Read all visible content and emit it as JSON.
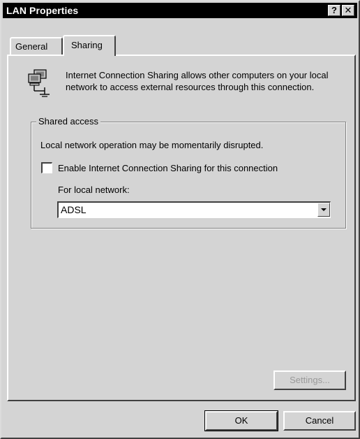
{
  "window": {
    "title": "LAN Properties",
    "help_button": "?",
    "close_button": "✕"
  },
  "tabs": [
    {
      "label": "General",
      "selected": false
    },
    {
      "label": "Sharing",
      "selected": true
    }
  ],
  "sharing": {
    "intro": "Internet Connection Sharing allows other computers on your local network to access external resources through this connection.",
    "icon": "network-computers-icon",
    "group_title": "Shared access",
    "disruption_text": "Local network operation may be momentarily disrupted.",
    "enable_checkbox": {
      "label": "Enable Internet Connection Sharing for this connection",
      "checked": false
    },
    "local_network_label": "For local network:",
    "local_network_value": "ADSL",
    "settings_label": "Settings..."
  },
  "footer": {
    "ok_label": "OK",
    "cancel_label": "Cancel"
  },
  "colors": {
    "face": "#d4d4d4",
    "titlebar": "#000000",
    "disabled_text": "#9a9a9a"
  }
}
